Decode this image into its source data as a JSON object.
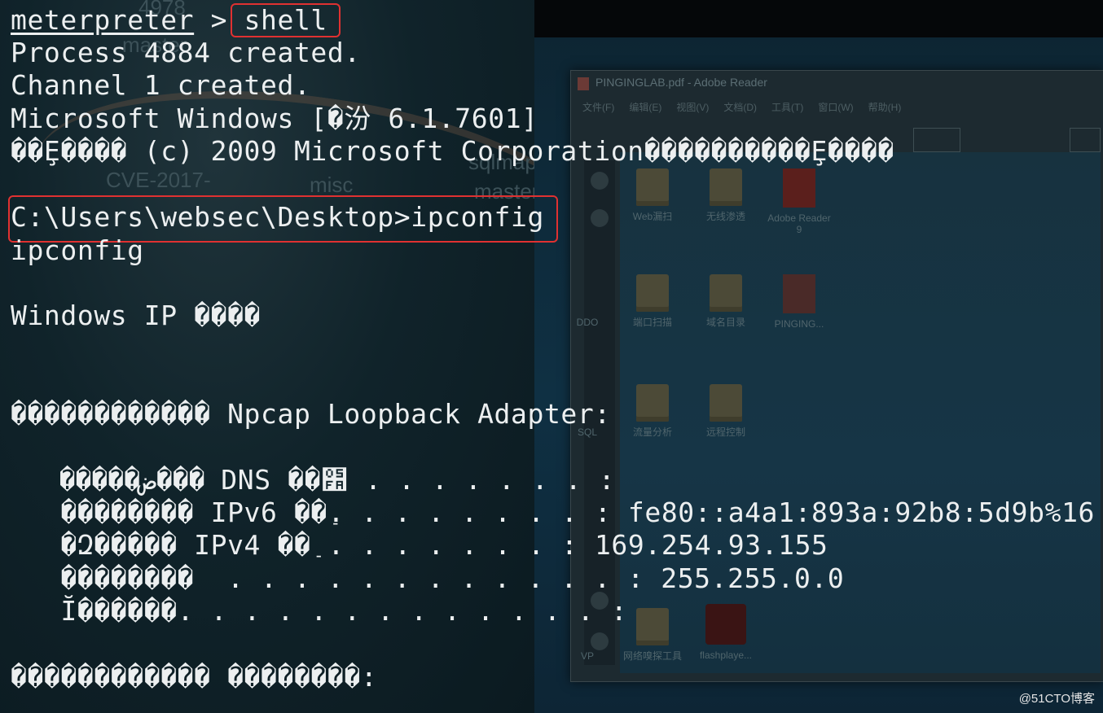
{
  "terminal": {
    "prompt": "meterpreter",
    "prompt_sep": " > ",
    "command1": "shell",
    "lines": [
      "Process 4884 created.",
      "Channel 1 created.",
      "Microsoft Windows [�汾 6.1.7601]",
      "��Ȩ���� (c) 2009 Microsoft Corporation����������Ȩ����"
    ],
    "cmd_line": "C:\\Users\\websec\\Desktop>ipconfig",
    "echo": "ipconfig",
    "win_ip": "Windows IP ����",
    "adapter": "������������ Npcap Loopback Adapter:",
    "details": [
      "   �����ض��� DNS ��׺ . . . . . . . :",
      "   �������� IPv6 ��ַ. . . . . . . . : fe80::a4a1:893a:92b8:5d9b%16",
      "   �Զ����� IPv4 ��ַ . . . . . . . : 169.254.93.155",
      "   ��������  . . . . . . . . . . . . : 255.255.0.0",
      "   Ĭ������. . . . . . . . . . . . . :"
    ],
    "last": "������������ ��������:"
  },
  "background": {
    "left_ghost": [
      "4978",
      "master",
      "CVE-2017-",
      "misc",
      "sqlmap",
      "master"
    ],
    "reader_title": "PINGINGLAB.pdf - Adobe Reader",
    "reader_menu": [
      "文件(F)",
      "编辑(E)",
      "视图(V)",
      "文档(D)",
      "工具(T)",
      "窗口(W)",
      "帮助(H)"
    ],
    "desktop_items": [
      "Web漏扫",
      "无线渗透",
      "Adobe Reader 9",
      "DDO",
      "端口扫描",
      "域名目录",
      "PINGING...",
      "SQL",
      "流量分析",
      "远程控制",
      "VP",
      "网络嗅探工具",
      "flashplaye..."
    ]
  },
  "watermark": "@51CTO博客"
}
